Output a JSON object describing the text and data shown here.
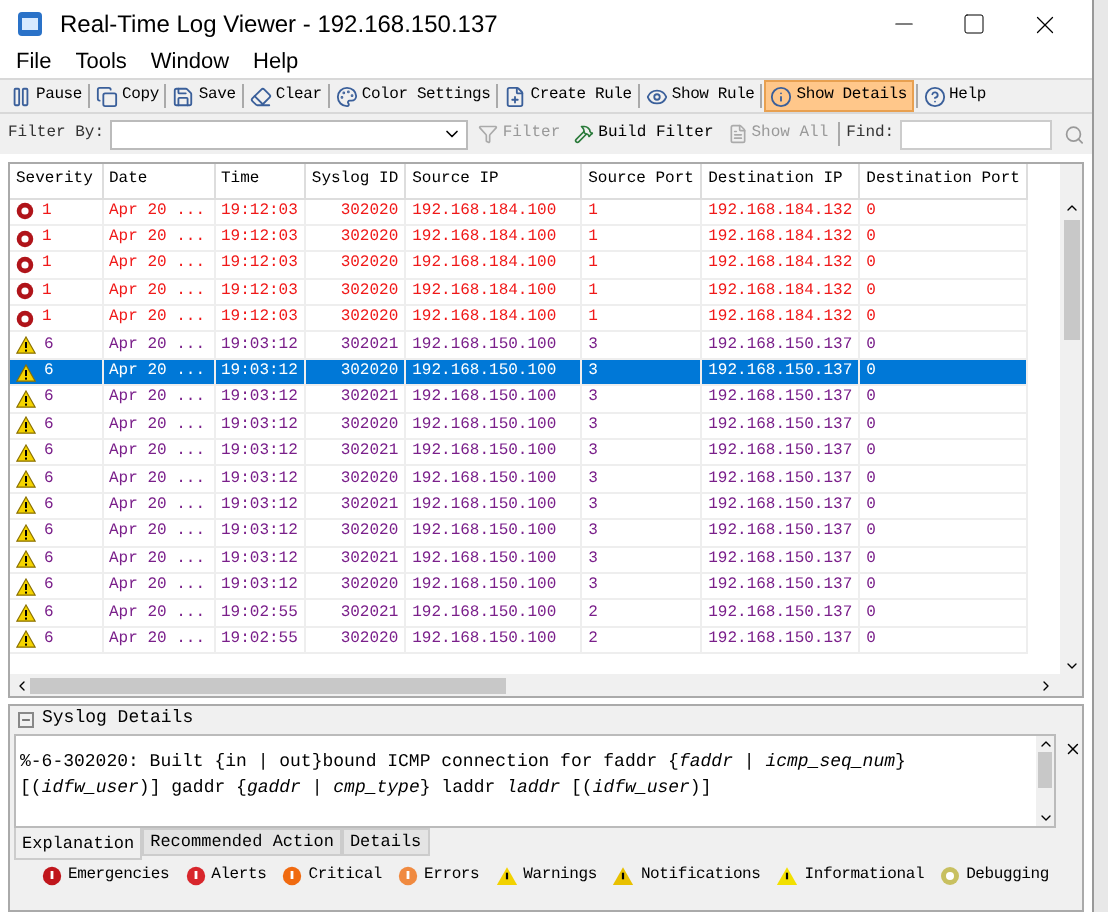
{
  "window": {
    "title": "Real-Time Log Viewer - 192.168.150.137"
  },
  "menu": [
    "File",
    "Tools",
    "Window",
    "Help"
  ],
  "toolbar": [
    {
      "kind": "pause",
      "label": "Pause",
      "selected": false
    },
    {
      "kind": "copy",
      "label": "Copy",
      "selected": false
    },
    {
      "kind": "save",
      "label": "Save",
      "selected": false
    },
    {
      "kind": "clear",
      "label": "Clear",
      "selected": false
    },
    {
      "kind": "color",
      "label": "Color Settings",
      "selected": false
    },
    {
      "kind": "create",
      "label": "Create Rule",
      "selected": false
    },
    {
      "kind": "show",
      "label": "Show Rule",
      "selected": false
    },
    {
      "kind": "details",
      "label": "Show Details",
      "selected": true
    },
    {
      "kind": "help",
      "label": "Help",
      "selected": false
    }
  ],
  "filter_bar": {
    "filter_by_label": "Filter By:",
    "filter_button": {
      "label": "Filter",
      "disabled": true
    },
    "build_filter_button": {
      "label": "Build Filter",
      "disabled": false
    },
    "show_all_button": {
      "label": "Show All",
      "disabled": true
    },
    "find_label": "Find:"
  },
  "table": {
    "columns": [
      "Severity",
      "Date",
      "Time",
      "Syslog ID",
      "Source IP",
      "Source Port",
      "Destination IP",
      "Destination Port"
    ],
    "rows": [
      {
        "kind": "alert",
        "selected": false,
        "cells": [
          "1",
          "Apr 20 ...",
          "19:12:03",
          "302020",
          "192.168.184.100",
          "1",
          "192.168.184.132",
          "0"
        ]
      },
      {
        "kind": "alert",
        "selected": false,
        "cells": [
          "1",
          "Apr 20 ...",
          "19:12:03",
          "302020",
          "192.168.184.100",
          "1",
          "192.168.184.132",
          "0"
        ]
      },
      {
        "kind": "alert",
        "selected": false,
        "cells": [
          "1",
          "Apr 20 ...",
          "19:12:03",
          "302020",
          "192.168.184.100",
          "1",
          "192.168.184.132",
          "0"
        ]
      },
      {
        "kind": "alert",
        "selected": false,
        "cells": [
          "1",
          "Apr 20 ...",
          "19:12:03",
          "302020",
          "192.168.184.100",
          "1",
          "192.168.184.132",
          "0"
        ]
      },
      {
        "kind": "alert",
        "selected": false,
        "cells": [
          "1",
          "Apr 20 ...",
          "19:12:03",
          "302020",
          "192.168.184.100",
          "1",
          "192.168.184.132",
          "0"
        ]
      },
      {
        "kind": "warning",
        "selected": false,
        "cells": [
          "6",
          "Apr 20 ...",
          "19:03:12",
          "302021",
          "192.168.150.100",
          "3",
          "192.168.150.137",
          "0"
        ]
      },
      {
        "kind": "warning",
        "selected": true,
        "cells": [
          "6",
          "Apr 20 ...",
          "19:03:12",
          "302020",
          "192.168.150.100",
          "3",
          "192.168.150.137",
          "0"
        ]
      },
      {
        "kind": "warning",
        "selected": false,
        "cells": [
          "6",
          "Apr 20 ...",
          "19:03:12",
          "302021",
          "192.168.150.100",
          "3",
          "192.168.150.137",
          "0"
        ]
      },
      {
        "kind": "warning",
        "selected": false,
        "cells": [
          "6",
          "Apr 20 ...",
          "19:03:12",
          "302020",
          "192.168.150.100",
          "3",
          "192.168.150.137",
          "0"
        ]
      },
      {
        "kind": "warning",
        "selected": false,
        "cells": [
          "6",
          "Apr 20 ...",
          "19:03:12",
          "302021",
          "192.168.150.100",
          "3",
          "192.168.150.137",
          "0"
        ]
      },
      {
        "kind": "warning",
        "selected": false,
        "cells": [
          "6",
          "Apr 20 ...",
          "19:03:12",
          "302020",
          "192.168.150.100",
          "3",
          "192.168.150.137",
          "0"
        ]
      },
      {
        "kind": "warning",
        "selected": false,
        "cells": [
          "6",
          "Apr 20 ...",
          "19:03:12",
          "302021",
          "192.168.150.100",
          "3",
          "192.168.150.137",
          "0"
        ]
      },
      {
        "kind": "warning",
        "selected": false,
        "cells": [
          "6",
          "Apr 20 ...",
          "19:03:12",
          "302020",
          "192.168.150.100",
          "3",
          "192.168.150.137",
          "0"
        ]
      },
      {
        "kind": "warning",
        "selected": false,
        "cells": [
          "6",
          "Apr 20 ...",
          "19:03:12",
          "302021",
          "192.168.150.100",
          "3",
          "192.168.150.137",
          "0"
        ]
      },
      {
        "kind": "warning",
        "selected": false,
        "cells": [
          "6",
          "Apr 20 ...",
          "19:03:12",
          "302020",
          "192.168.150.100",
          "3",
          "192.168.150.137",
          "0"
        ]
      },
      {
        "kind": "warning",
        "selected": false,
        "cells": [
          "6",
          "Apr 20 ...",
          "19:02:55",
          "302021",
          "192.168.150.100",
          "2",
          "192.168.150.137",
          "0"
        ]
      },
      {
        "kind": "warning",
        "selected": false,
        "cells": [
          "6",
          "Apr 20 ...",
          "19:02:55",
          "302020",
          "192.168.150.100",
          "2",
          "192.168.150.137",
          "0"
        ]
      }
    ]
  },
  "details": {
    "title": "Syslog Details",
    "text": "%-6-302020: Built {in | out}bound ICMP connection for faddr {*faddr* | *icmp_seq_num*} [(*idfw_user*)] gaddr {*gaddr* | *cmp_type*} laddr *laddr* [(*idfw_user*)]",
    "tabs": [
      {
        "label": "Explanation",
        "selected": true
      },
      {
        "label": "Recommended Action",
        "selected": false
      },
      {
        "label": "Details",
        "selected": false
      }
    ]
  },
  "legend": [
    {
      "kind": "emergency",
      "label": "Emergencies",
      "color": "#c0161c"
    },
    {
      "kind": "alert",
      "label": "Alerts",
      "color": "#d8262c"
    },
    {
      "kind": "critical",
      "label": "Critical",
      "color": "#f06a10"
    },
    {
      "kind": "error",
      "label": "Errors",
      "color": "#f08a40"
    },
    {
      "kind": "warning",
      "label": "Warnings",
      "color": "#f2d200"
    },
    {
      "kind": "notification",
      "label": "Notifications",
      "color": "#e8c000"
    },
    {
      "kind": "warning",
      "label": "Informational",
      "color": "#f2e000"
    },
    {
      "kind": "debug",
      "label": "Debugging",
      "color": "#c8c060"
    }
  ]
}
